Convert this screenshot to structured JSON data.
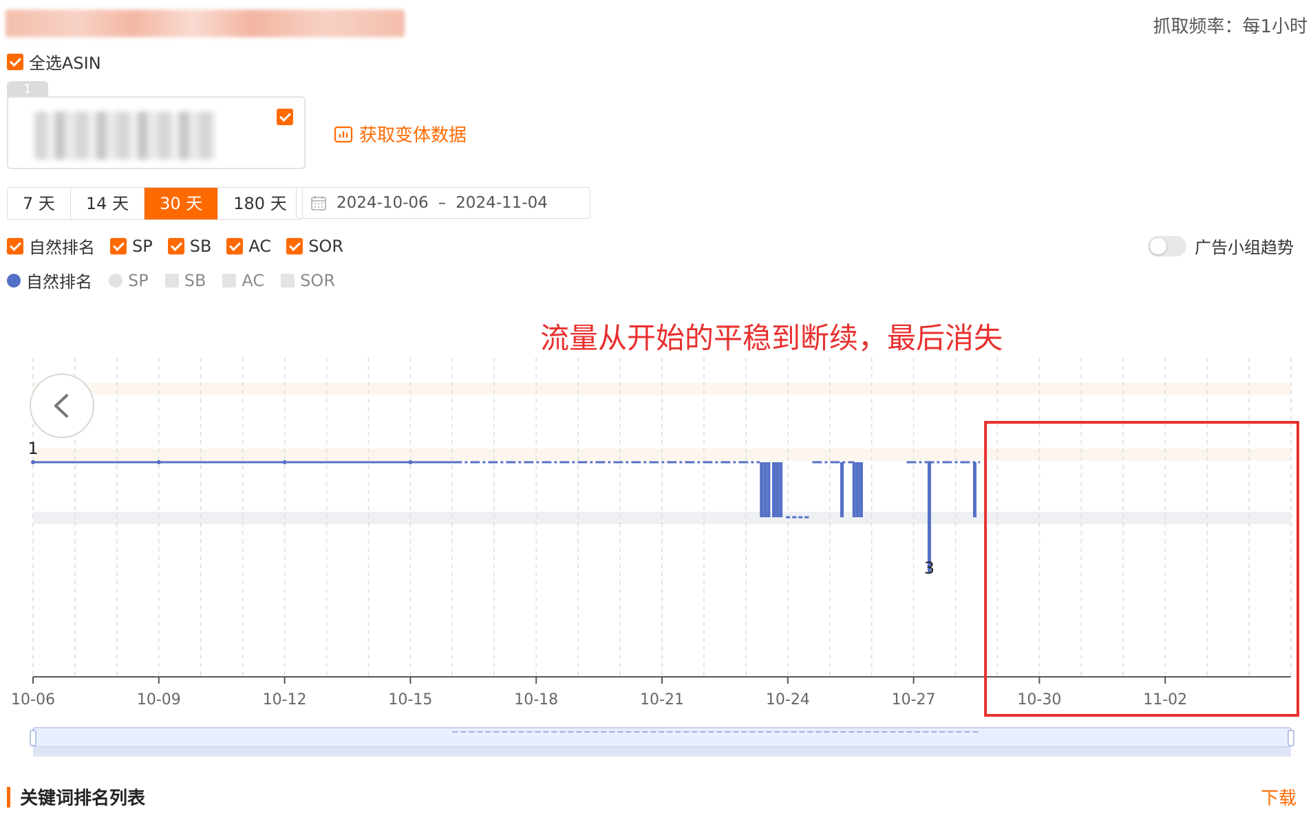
{
  "header": {
    "frequency_label": "抓取频率：每1小时"
  },
  "select_all": {
    "label": "全选ASIN",
    "checked": true
  },
  "asin_card": {
    "tab_number": "1",
    "checked": true
  },
  "variant_button": {
    "label": "获取变体数据"
  },
  "period_tabs": [
    {
      "label": "7 天",
      "active": false
    },
    {
      "label": "14 天",
      "active": false
    },
    {
      "label": "30 天",
      "active": true
    },
    {
      "label": "180 天",
      "active": false
    }
  ],
  "date_range": {
    "start": "2024-10-06",
    "separator": "–",
    "end": "2024-11-04"
  },
  "filters": [
    {
      "label": "自然排名",
      "checked": true
    },
    {
      "label": "SP",
      "checked": true
    },
    {
      "label": "SB",
      "checked": true
    },
    {
      "label": "AC",
      "checked": true
    },
    {
      "label": "SOR",
      "checked": true
    }
  ],
  "ad_group_toggle": {
    "label": "广告小组趋势",
    "on": false
  },
  "legend": [
    {
      "label": "自然排名",
      "active": true,
      "shape": "circle",
      "color": "#5470c6"
    },
    {
      "label": "SP",
      "active": false,
      "shape": "circle",
      "color": "#e3e3e3"
    },
    {
      "label": "SB",
      "active": false,
      "shape": "square",
      "color": "#e3e3e3"
    },
    {
      "label": "AC",
      "active": false,
      "shape": "square",
      "color": "#e3e3e3"
    },
    {
      "label": "SOR",
      "active": false,
      "shape": "square",
      "color": "#e3e3e3"
    }
  ],
  "chart_data": {
    "type": "line",
    "annotation": "流量从开始的平稳到断续，最后消失",
    "x_tick_labels": [
      "10-06",
      "10-09",
      "10-12",
      "10-15",
      "10-18",
      "10-21",
      "10-24",
      "10-27",
      "10-30",
      "11-02"
    ],
    "xlim": [
      "2024-10-06",
      "2024-11-05"
    ],
    "y_labels": [
      {
        "value": 1,
        "label": "1"
      },
      {
        "value": 3,
        "label": "3"
      }
    ],
    "ylim": [
      0,
      5
    ],
    "y_inverted": true,
    "grid": "vertical-dashed",
    "highlight_box_from": "2024-10-28T14:00",
    "series": [
      {
        "name": "自然排名",
        "color": "#5470c6",
        "solid_segments": [
          [
            "2024-10-06T00:00",
            "2024-10-16T00:00"
          ]
        ],
        "dashed_segments": [
          [
            "2024-10-16T00:00",
            "2024-10-23T08:00"
          ],
          [
            "2024-10-24T14:00",
            "2024-10-25T14:00"
          ],
          [
            "2024-10-26T20:00",
            "2024-10-28T14:00"
          ]
        ],
        "drops": [
          {
            "x": "2024-10-23T09:00",
            "y": 2
          },
          {
            "x": "2024-10-23T11:00",
            "y": 2
          },
          {
            "x": "2024-10-23T13:00",
            "y": 2
          },
          {
            "x": "2024-10-23T16:00",
            "y": 2
          },
          {
            "x": "2024-10-23T18:00",
            "y": 2
          },
          {
            "x": "2024-10-23T20:00",
            "y": 2
          },
          {
            "x": "2024-10-25T07:00",
            "y": 2
          },
          {
            "x": "2024-10-25T14:00",
            "y": 2
          },
          {
            "x": "2024-10-25T16:00",
            "y": 2
          },
          {
            "x": "2024-10-25T18:00",
            "y": 2
          },
          {
            "x": "2024-10-27T09:00",
            "y": 3
          },
          {
            "x": "2024-10-28T11:00",
            "y": 2
          }
        ],
        "rank2_plateau": [
          "2024-10-23T23:00",
          "2024-10-24T12:00"
        ]
      }
    ]
  },
  "keyword_section": {
    "title": "关键词排名列表",
    "download_label": "下载"
  }
}
